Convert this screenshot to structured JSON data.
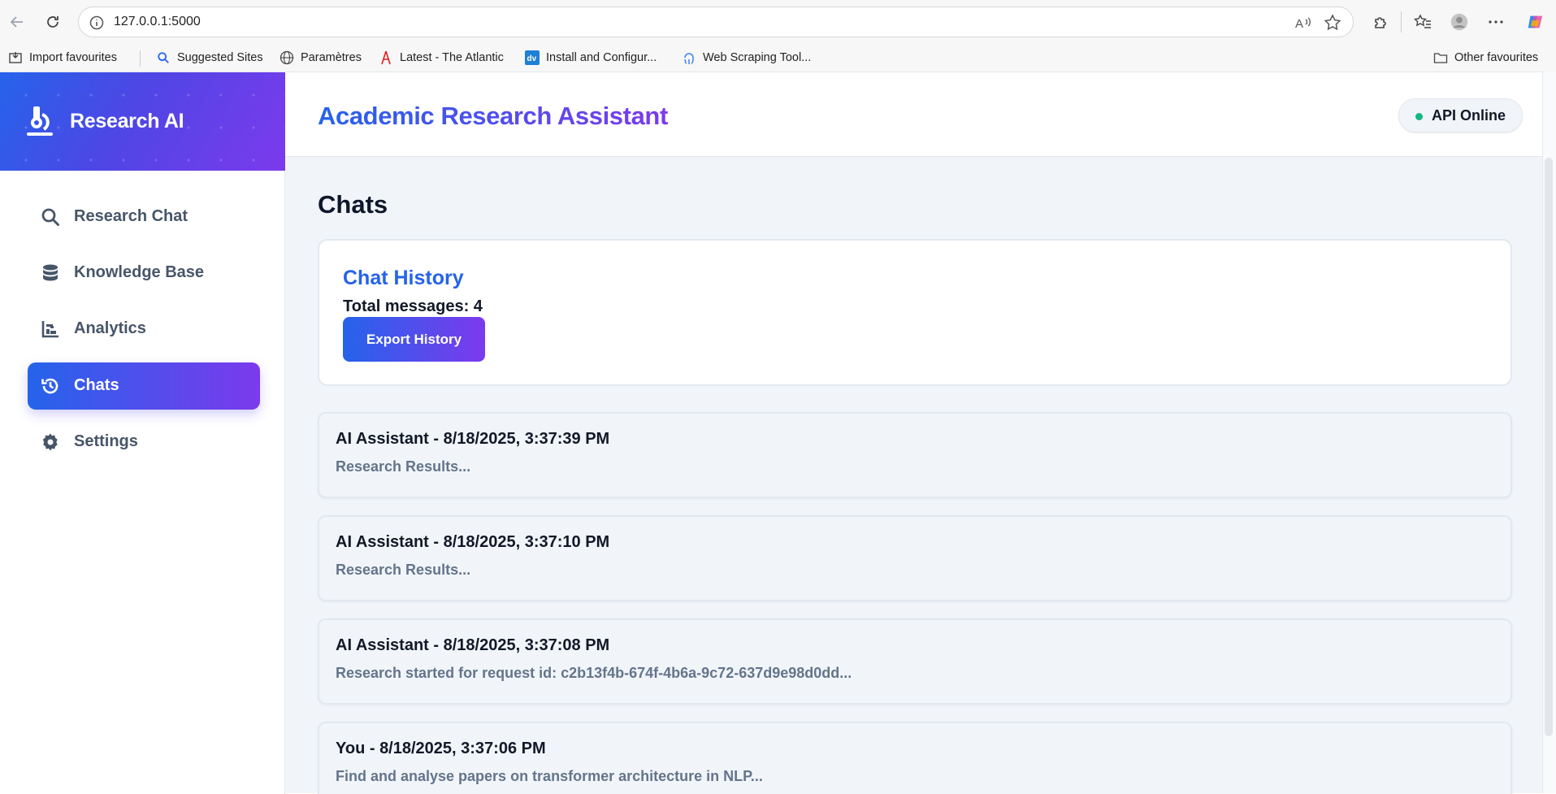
{
  "browser": {
    "url": "127.0.0.1:5000",
    "bookmarks": [
      {
        "label": "Import favourites",
        "icon": "import-icon"
      },
      {
        "label": "Suggested Sites",
        "icon": "search-icon"
      },
      {
        "label": "Paramètres",
        "icon": "globe-icon"
      },
      {
        "label": "Latest - The Atlantic",
        "icon": "atlantic-icon"
      },
      {
        "label": "Install and Configur...",
        "icon": "dv-icon"
      },
      {
        "label": "Web Scraping Tool...",
        "icon": "octopus-icon"
      }
    ],
    "other_favourites": "Other favourites"
  },
  "sidebar": {
    "brand": "Research AI",
    "items": [
      {
        "label": "Research Chat",
        "icon": "search-icon",
        "active": false
      },
      {
        "label": "Knowledge Base",
        "icon": "database-icon",
        "active": false
      },
      {
        "label": "Analytics",
        "icon": "chart-icon",
        "active": false
      },
      {
        "label": "Chats",
        "icon": "history-icon",
        "active": true
      },
      {
        "label": "Settings",
        "icon": "gear-icon",
        "active": false
      }
    ]
  },
  "header": {
    "title": "Academic Research Assistant",
    "status": "API Online"
  },
  "main": {
    "page_title": "Chats",
    "history_card": {
      "title": "Chat History",
      "total": "Total messages: 4",
      "export_label": "Export History"
    },
    "messages": [
      {
        "header": "AI Assistant - 8/18/2025, 3:37:39 PM",
        "body": "Research Results..."
      },
      {
        "header": "AI Assistant - 8/18/2025, 3:37:10 PM",
        "body": "Research Results..."
      },
      {
        "header": "AI Assistant - 8/18/2025, 3:37:08 PM",
        "body": "Research started for request id: c2b13f4b-674f-4b6a-9c72-637d9e98d0dd..."
      },
      {
        "header": "You - 8/18/2025, 3:37:06 PM",
        "body": "Find and analyse papers on transformer architecture in NLP..."
      }
    ]
  },
  "colors": {
    "accent_start": "#2563eb",
    "accent_end": "#7c3aed",
    "status_green": "#10b981"
  }
}
